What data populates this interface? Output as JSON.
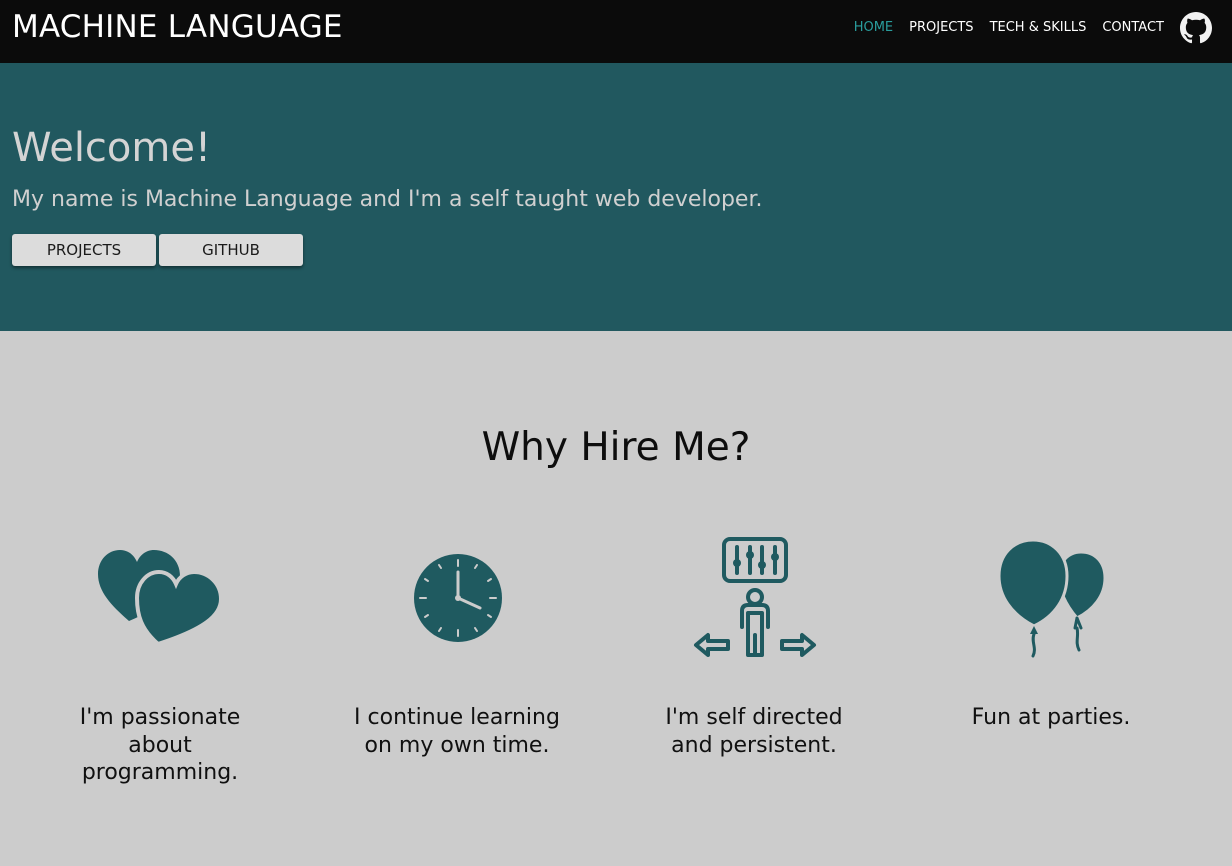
{
  "navbar": {
    "brand": "MACHINE LANGUAGE",
    "links": [
      {
        "label": "HOME",
        "active": true
      },
      {
        "label": "PROJECTS",
        "active": false
      },
      {
        "label": "TECH & SKILLS",
        "active": false
      },
      {
        "label": "CONTACT",
        "active": false
      }
    ],
    "github_icon": "github-icon"
  },
  "hero": {
    "title": "Welcome!",
    "subtitle": "My name is Machine Language and I'm a self taught web developer.",
    "buttons": [
      {
        "label": "PROJECTS"
      },
      {
        "label": "GITHUB"
      }
    ]
  },
  "why": {
    "title": "Why Hire Me?",
    "features": [
      {
        "icon": "hearts-icon",
        "text": "I'm passionate about programming."
      },
      {
        "icon": "clock-icon",
        "text": "I continue learning on my own time."
      },
      {
        "icon": "self-directed-icon",
        "text": "I'm self directed and persistent."
      },
      {
        "icon": "balloons-icon",
        "text": "Fun at parties."
      }
    ]
  },
  "colors": {
    "navbar_bg": "#0b0b0b",
    "accent": "#2a9d9d",
    "hero_bg": "#21585f",
    "icon_fill": "#1f5a60",
    "page_bg": "#cccccc"
  }
}
